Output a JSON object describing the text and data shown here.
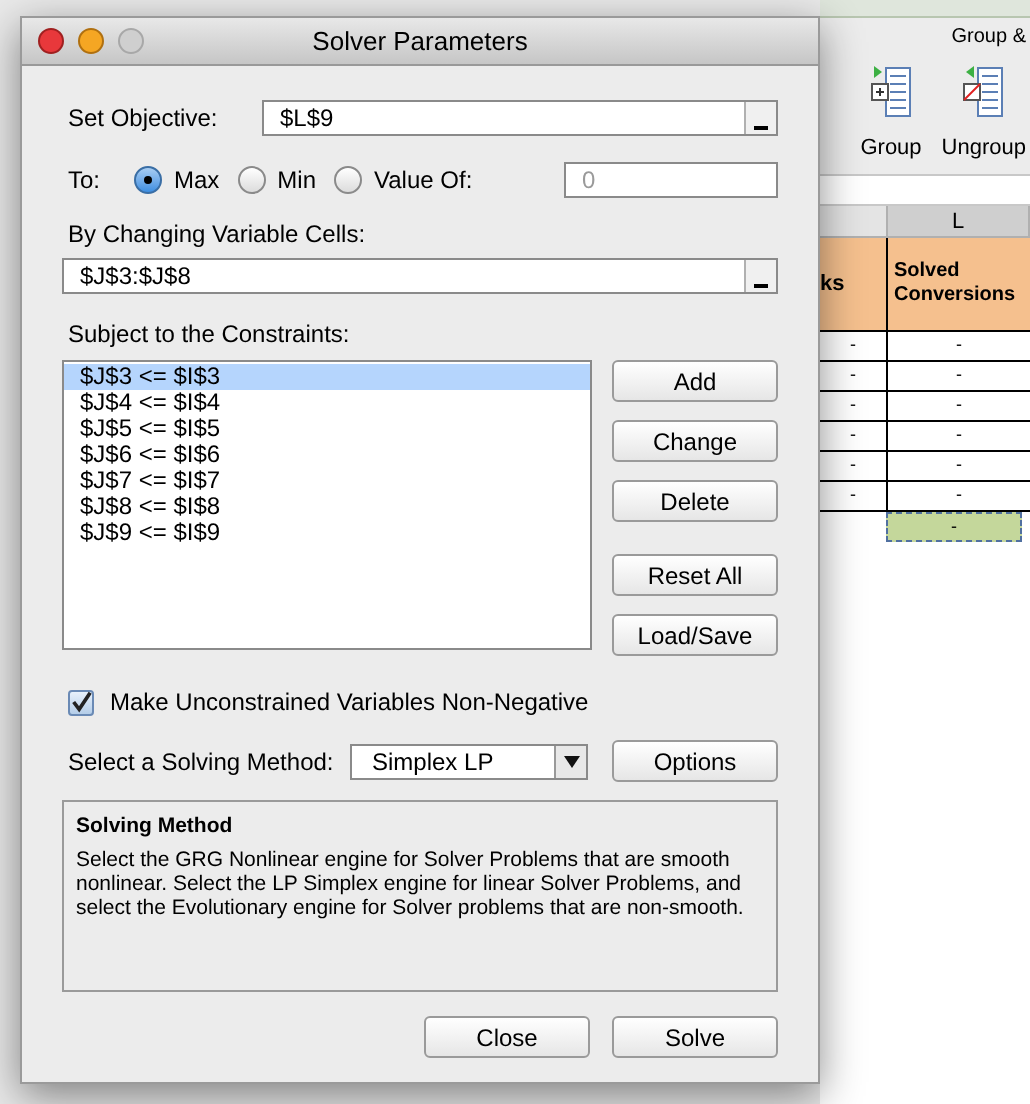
{
  "background": {
    "ribbon": {
      "group_label": "Group &",
      "buttons": [
        {
          "label": "Group"
        },
        {
          "label": "Ungroup"
        }
      ]
    },
    "sheet": {
      "column_header": "L",
      "header_cells": [
        "ks",
        "Solved Conversions"
      ],
      "rows": [
        [
          "-",
          "-"
        ],
        [
          "-",
          "-"
        ],
        [
          "-",
          "-"
        ],
        [
          "-",
          "-"
        ],
        [
          "-",
          "-"
        ],
        [
          "-",
          "-"
        ]
      ],
      "selected_cell": "-"
    }
  },
  "dialog": {
    "title": "Solver Parameters",
    "objective": {
      "label": "Set Objective:",
      "value": "$L$9"
    },
    "to": {
      "label": "To:",
      "options": [
        {
          "label": "Max",
          "selected": true
        },
        {
          "label": "Min",
          "selected": false
        },
        {
          "label": "Value Of:",
          "selected": false
        }
      ],
      "value_field": {
        "value": "0",
        "disabled": true
      }
    },
    "variables": {
      "label": "By Changing Variable Cells:",
      "value": "$J$3:$J$8"
    },
    "constraints": {
      "label": "Subject to the Constraints:",
      "items": [
        {
          "text": "$J$3 <= $I$3",
          "selected": true
        },
        {
          "text": "$J$4 <= $I$4",
          "selected": false
        },
        {
          "text": "$J$5 <= $I$5",
          "selected": false
        },
        {
          "text": "$J$6 <= $I$6",
          "selected": false
        },
        {
          "text": "$J$7 <= $I$7",
          "selected": false
        },
        {
          "text": "$J$8 <= $I$8",
          "selected": false
        },
        {
          "text": "$J$9 <= $I$9",
          "selected": false
        }
      ],
      "buttons": [
        "Add",
        "Change",
        "Delete",
        "Reset All",
        "Load/Save"
      ]
    },
    "non_negative": {
      "label": "Make Unconstrained Variables Non-Negative",
      "checked": true
    },
    "method": {
      "label": "Select a Solving Method:",
      "value": "Simplex LP",
      "button": "Options"
    },
    "description": {
      "title": "Solving Method",
      "text": "Select the GRG Nonlinear engine for Solver Problems that are smooth nonlinear. Select the LP Simplex engine for linear Solver Problems, and select the Evolutionary engine for Solver problems that are non-smooth."
    },
    "footer_buttons": [
      "Close",
      "Solve"
    ]
  }
}
